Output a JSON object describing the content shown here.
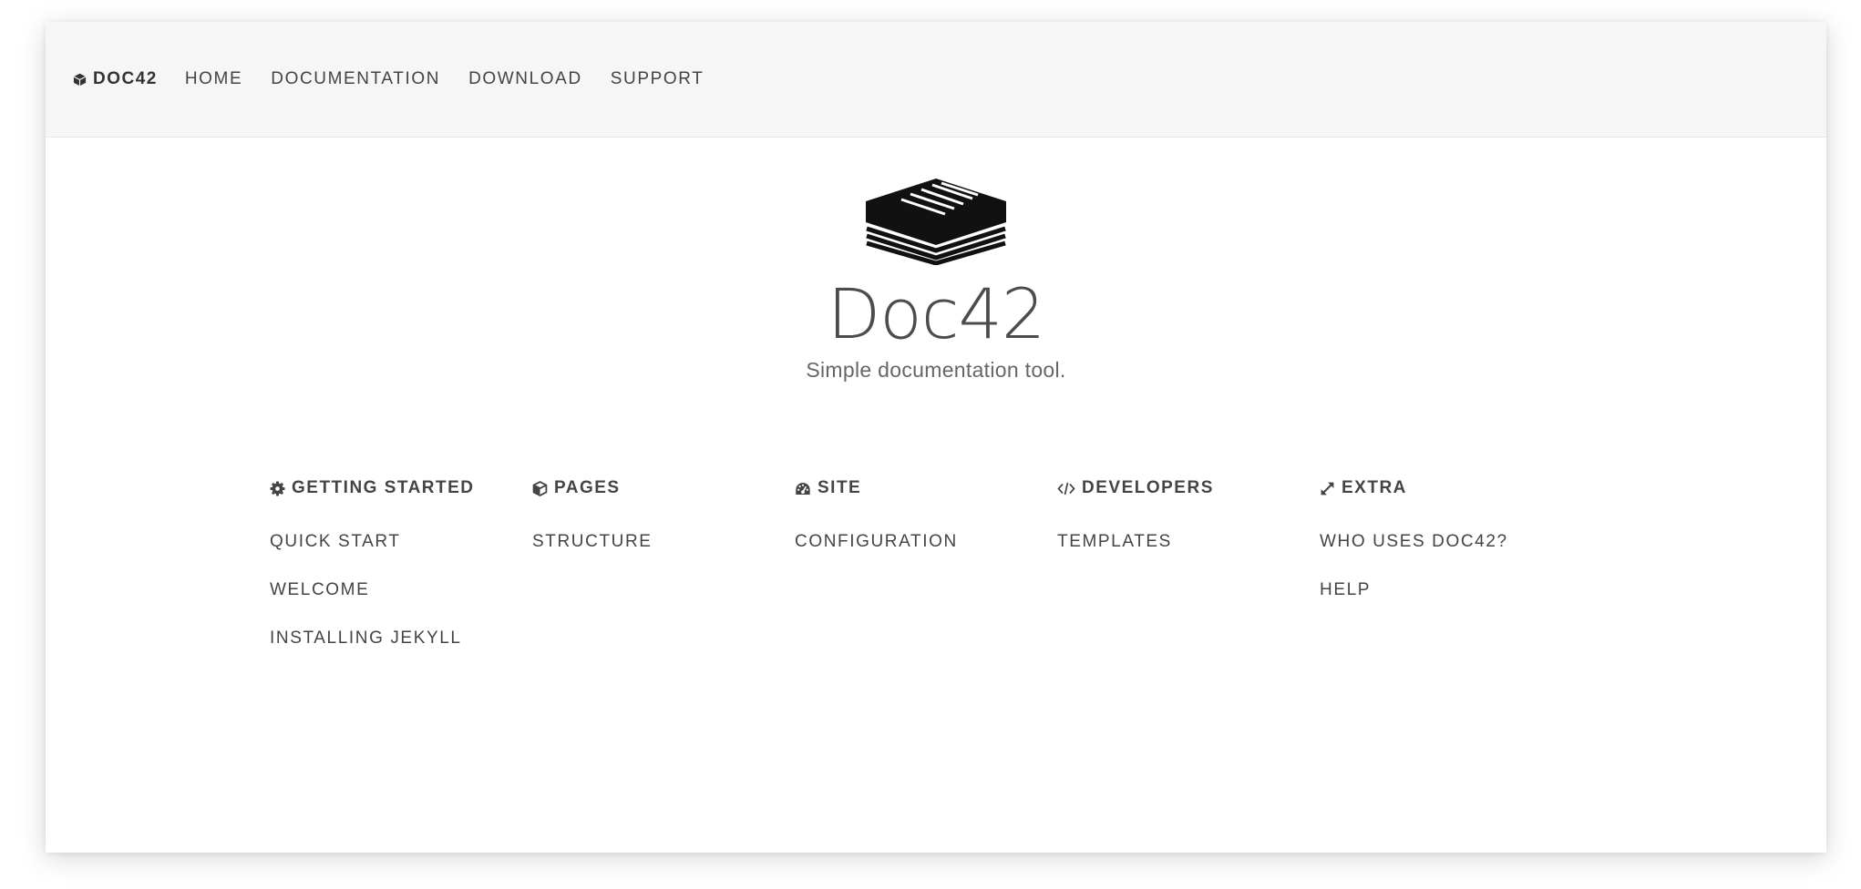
{
  "navbar": {
    "brand": "DOC42",
    "links": [
      "HOME",
      "DOCUMENTATION",
      "DOWNLOAD",
      "SUPPORT"
    ]
  },
  "hero": {
    "title": "Doc42",
    "tagline": "Simple documentation tool."
  },
  "sections": [
    {
      "heading": "GETTING STARTED",
      "icon": "gear-icon",
      "links": [
        "QUICK START",
        "WELCOME",
        "INSTALLING JEKYLL"
      ]
    },
    {
      "heading": "PAGES",
      "icon": "cube-icon",
      "links": [
        "STRUCTURE"
      ]
    },
    {
      "heading": "SITE",
      "icon": "dashboard-icon",
      "links": [
        "CONFIGURATION"
      ]
    },
    {
      "heading": "DEVELOPERS",
      "icon": "code-icon",
      "links": [
        "TEMPLATES"
      ]
    },
    {
      "heading": "EXTRA",
      "icon": "expand-icon",
      "links": [
        "WHO USES DOC42?",
        "HELP"
      ]
    }
  ],
  "colors": {
    "navbar_bg": "#f6f6f6",
    "text": "#444444",
    "title": "#4c4c4c"
  }
}
